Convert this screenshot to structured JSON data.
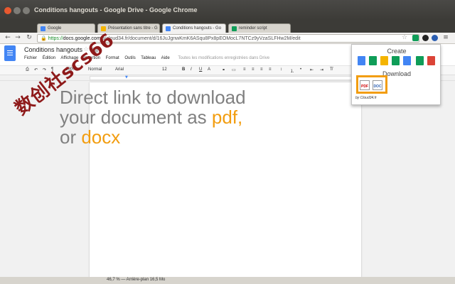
{
  "window": {
    "title": "Conditions hangouts - Google Drive - Google Chrome"
  },
  "tabs": [
    {
      "label": "Google",
      "icon": "google-favicon",
      "color": "#4285f4"
    },
    {
      "label": "Présentation sans titre - G",
      "icon": "slides-favicon",
      "color": "#f4b400"
    },
    {
      "label": "Conditions hangouts - Go",
      "icon": "docs-favicon",
      "color": "#4285f4",
      "active": true
    },
    {
      "label": "reminder script",
      "icon": "sheets-favicon",
      "color": "#0f9d58"
    }
  ],
  "address": {
    "scheme": "https://",
    "host": "docs.google.com",
    "path": "/a/cloud34.fr/document/d/16JuJgnwKmK6ASqu8Px8pEOMocL7NTCz9yVzaSLFHw2M/edit"
  },
  "docs": {
    "title": "Conditions hangouts",
    "menu": [
      "Fichier",
      "Édition",
      "Affichage",
      "Insertion",
      "Format",
      "Outils",
      "Tableau",
      "Aide"
    ],
    "saved_status": "Toutes les modifications enregistrées dans Drive",
    "toolbar": {
      "zoom": "100%",
      "style": "Normal",
      "font": "Arial",
      "size": "12"
    }
  },
  "overlay": {
    "line1": "Direct link to download",
    "line2_pre": "your document as ",
    "line2_hl": "pdf,",
    "line3_pre": "or ",
    "line3_hl": "docx",
    "highlight_color": "#f29d10",
    "text_color": "#808080"
  },
  "watermark": {
    "text": "数创社scs66"
  },
  "popup": {
    "create_heading": "Create",
    "download_heading": "Download",
    "create_apps": [
      {
        "icon": "docs-icon",
        "color": "#4285f4"
      },
      {
        "icon": "sheets-icon",
        "color": "#0f9d58"
      },
      {
        "icon": "slides-icon",
        "color": "#f4b400"
      },
      {
        "icon": "forms-icon",
        "color": "#0f9d58"
      },
      {
        "icon": "drawings-icon",
        "color": "#4285f4"
      },
      {
        "icon": "sites-icon",
        "color": "#0f9d58"
      },
      {
        "icon": "scripts-icon",
        "color": "#db4437"
      }
    ],
    "download_formats": [
      "PDF",
      "DOC"
    ],
    "credit": "by Cloud34.fr"
  },
  "statusbar": {
    "text": "46,7 % — Arrière-plan 16,5 Mo"
  }
}
